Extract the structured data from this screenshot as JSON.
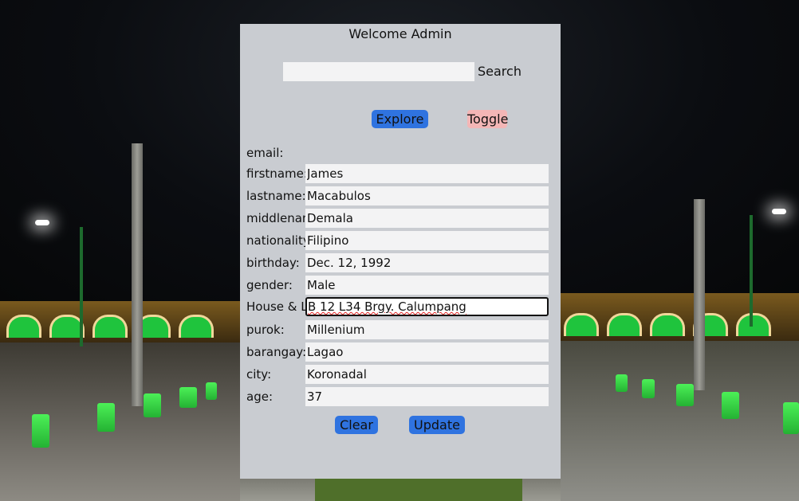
{
  "header": {
    "welcome_text": "Welcome Admin"
  },
  "search": {
    "value": "",
    "button_label": "Search"
  },
  "actions": {
    "explore_label": "Explore",
    "toggle_label": "Toggle",
    "clear_label": "Clear",
    "update_label": "Update"
  },
  "form": {
    "fields": [
      {
        "label": "email:",
        "value": ""
      },
      {
        "label": "firstname:",
        "value": "James"
      },
      {
        "label": "lastname:",
        "value": "Macabulos"
      },
      {
        "label": "middlename:",
        "value": "Demala"
      },
      {
        "label": "nationality:",
        "value": "Filipino"
      },
      {
        "label": "birthday:",
        "value": "Dec. 12, 1992"
      },
      {
        "label": "gender:",
        "value": "Male"
      },
      {
        "label": "House & Lot:",
        "value": "B 12 L34 Brgy. Calumpang"
      },
      {
        "label": "purok:",
        "value": "Millenium"
      },
      {
        "label": "barangay:",
        "value": "Lagao"
      },
      {
        "label": "city:",
        "value": "Koronadal"
      },
      {
        "label": "age:",
        "value": "37"
      }
    ]
  },
  "colors": {
    "panel": "#c9ccd1",
    "primary_button": "#2f73e0",
    "toggle_button": "#f3b6b6",
    "input_bg": "#f3f3f4"
  }
}
